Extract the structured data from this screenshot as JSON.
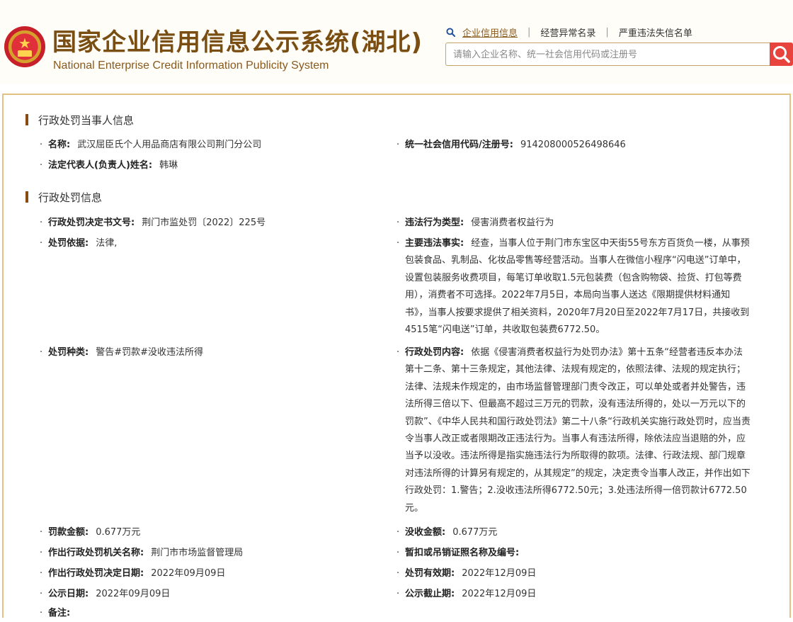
{
  "header": {
    "title": "国家企业信用信息公示系统(湖北)",
    "subtitle": "National Enterprise Credit Information Publicity System",
    "nav": [
      "企业信用信息",
      "经营异常名录",
      "严重违法失信名单"
    ],
    "search_placeholder": "请输入企业名称、统一社会信用代码或注册号"
  },
  "party": {
    "section_title": "行政处罚当事人信息",
    "name_label": "名称:",
    "name_value": "武汉屈臣氏个人用品商店有限公司荆门分公司",
    "credit_code_label": "统一社会信用代码/注册号:",
    "credit_code_value": "914208000526498646",
    "legal_rep_label": "法定代表人(负责人)姓名:",
    "legal_rep_value": "韩琳"
  },
  "penalty": {
    "section_title": "行政处罚信息",
    "doc_no_label": "行政处罚决定书文号:",
    "doc_no_value": "荆门市监处罚〔2022〕225号",
    "violation_type_label": "违法行为类型:",
    "violation_type_value": "侵害消费者权益行为",
    "basis_label": "处罚依据:",
    "basis_value": "法律,",
    "facts_label": "主要违法事实:",
    "facts_value": "经查，当事人位于荆门市东宝区中天街55号东方百货负一楼，从事预包装食品、乳制品、化妆品零售等经营活动。当事人在微信小程序“闪电送”订单中，设置包装服务收费项目，每笔订单收取1.5元包装费（包含购物袋、捡货、打包等费用），消费者不可选择。2022年7月5日，本局向当事人送达《限期提供材料通知书》，当事人按要求提供了相关资料，2020年7月20日至2022年7月17日，共接收到4515笔“闪电送”订单，共收取包装费6772.50。",
    "kind_label": "处罚种类:",
    "kind_value": "警告#罚款#没收违法所得",
    "content_label": "行政处罚内容:",
    "content_value": "依据《侵害消费者权益行为处罚办法》第十五条“经营者违反本办法第十二条、第十三条规定，其他法律、法规有规定的，依照法律、法规的规定执行；法律、法规未作规定的，由市场监督管理部门责令改正，可以单处或者并处警告，违法所得三倍以下、但最高不超过三万元的罚款，没有违法所得的，处以一万元以下的罚款”、《中华人民共和国行政处罚法》第二十八条“行政机关实施行政处罚时，应当责令当事人改正或者限期改正违法行为。当事人有违法所得，除依法应当退赔的外，应当予以没收。违法所得是指实施违法行为所取得的款项。法律、行政法规、部门规章对违法所得的计算另有规定的，从其规定”的规定，决定责令当事人改正，并作出如下行政处罚：1.警告；2.没收违法所得6772.50元；3.处违法所得一倍罚款计6772.50元。",
    "fine_label": "罚款金额:",
    "fine_value": "0.677万元",
    "confiscation_label": "没收金额:",
    "confiscation_value": "0.677万元",
    "authority_label": "作出行政处罚机关名称:",
    "authority_value": "荆门市市场监督管理局",
    "license_label": "暂扣或吊销证照名称及编号:",
    "license_value": "",
    "decision_date_label": "作出行政处罚决定日期:",
    "decision_date_value": "2022年09月09日",
    "validity_label": "处罚有效期:",
    "validity_value": "2022年12月09日",
    "publish_date_label": "公示日期:",
    "publish_date_value": "2022年09月09日",
    "publish_end_label": "公示截止期:",
    "publish_end_value": "2022年12月09日",
    "remark_label": "备注:"
  },
  "colors": {
    "brand": "#7a4e12",
    "frame_border": "#e0c283",
    "search_button": "#e8443d"
  }
}
